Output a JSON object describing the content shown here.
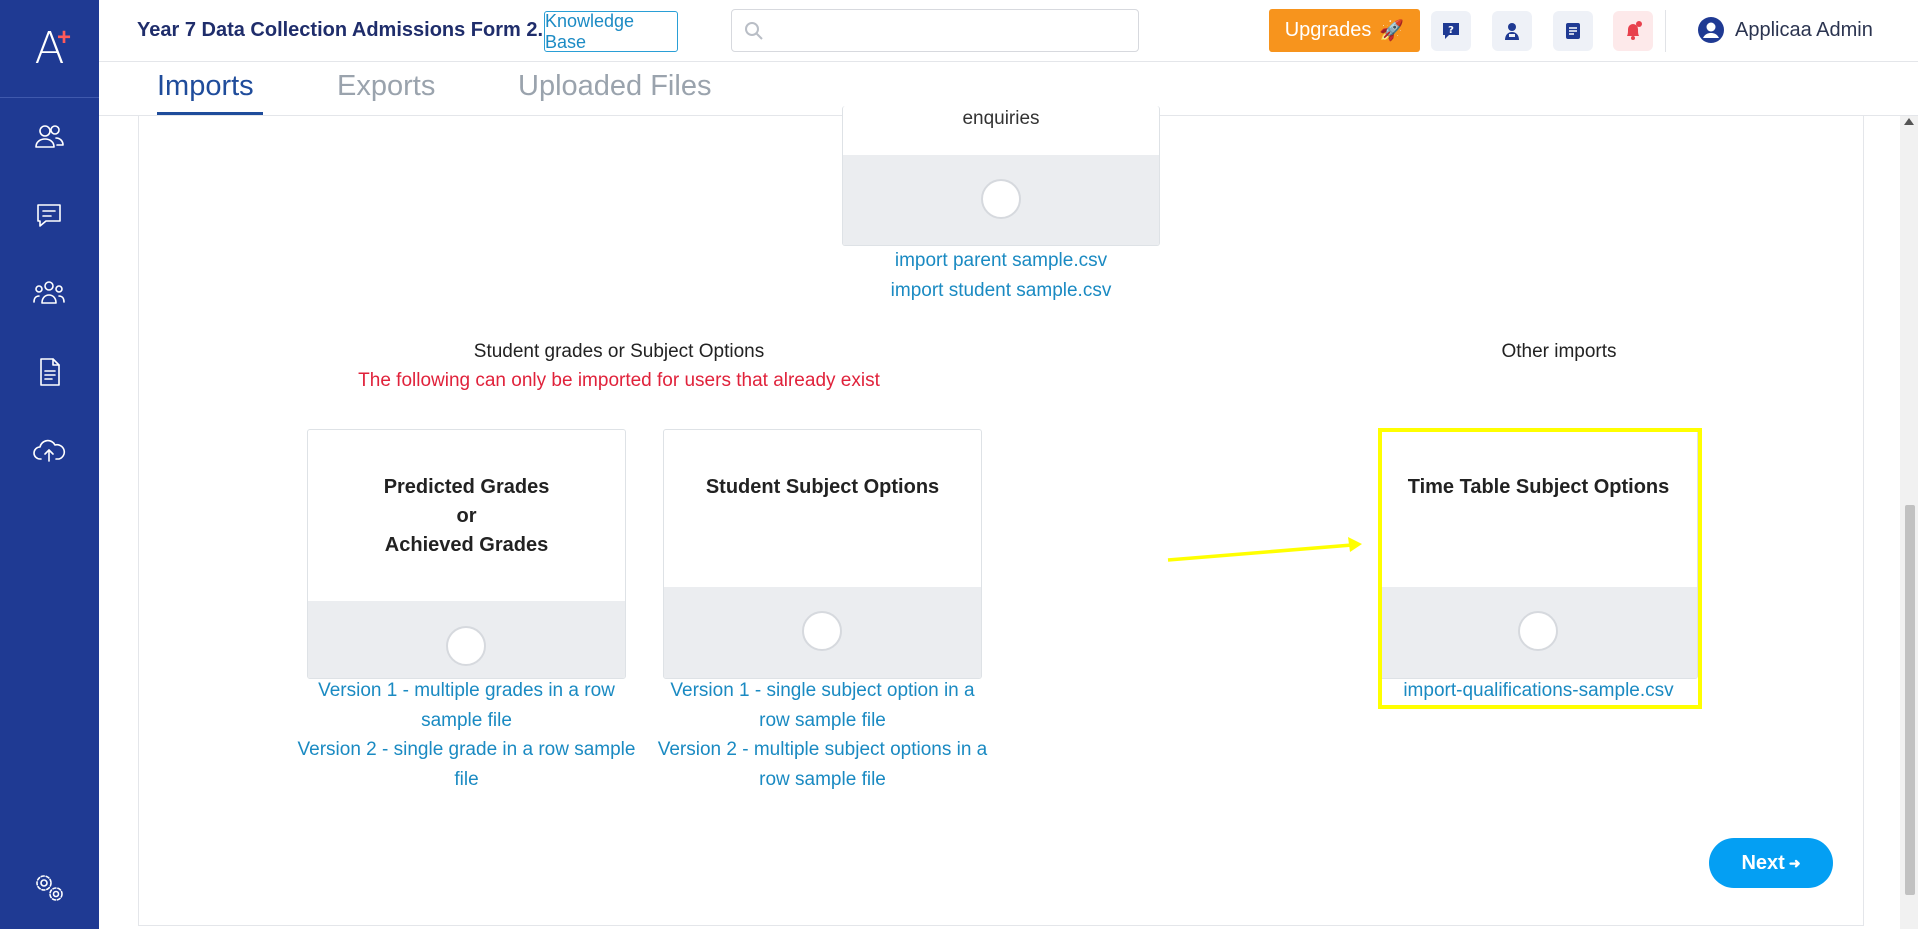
{
  "sidebar": {
    "logo_letter": "A",
    "logo_plus": "+",
    "items": [
      {
        "name": "contacts",
        "icon": "people-icon"
      },
      {
        "name": "messages",
        "icon": "chat-icon"
      },
      {
        "name": "groups",
        "icon": "group-icon"
      },
      {
        "name": "documents",
        "icon": "document-icon"
      },
      {
        "name": "uploads",
        "icon": "cloud-upload-icon"
      },
      {
        "name": "settings",
        "icon": "gears-icon"
      }
    ]
  },
  "header": {
    "title": "Year 7 Data Collection Admissions Form 2...",
    "knowledge_base_label": "Knowledge Base",
    "search_placeholder": "",
    "upgrades_label": "Upgrades",
    "upgrades_emoji": "🚀",
    "user_name": "Applicaa Admin",
    "accent_color": "#f7941d",
    "brand_color": "#1f3a93"
  },
  "tabs": [
    {
      "label": "Imports",
      "active": true
    },
    {
      "label": "Exports",
      "active": false
    },
    {
      "label": "Uploaded Files",
      "active": false
    }
  ],
  "main": {
    "top_card": {
      "title_partial": "enquiries",
      "links": [
        "import parent sample.csv",
        "import student sample.csv"
      ]
    },
    "grades_section": {
      "label": "Student grades or Subject Options",
      "warning": "The following can only be imported for users that already exist",
      "cards": [
        {
          "title_lines": [
            "Predicted Grades",
            "or",
            "Achieved Grades"
          ],
          "links": [
            "Version 1 - multiple grades in a row sample file",
            "Version 2 - single grade in a row sample file"
          ]
        },
        {
          "title_lines": [
            "Student Subject Options"
          ],
          "links": [
            "Version 1 - single subject option in a row sample file",
            "Version 2 - multiple subject options in a row sample file"
          ]
        }
      ]
    },
    "other_section": {
      "label": "Other imports",
      "card": {
        "title": "Time Table Subject Options",
        "link": "import-qualifications-sample.csv"
      }
    },
    "next_label": "Next",
    "next_arrow": "➜"
  }
}
